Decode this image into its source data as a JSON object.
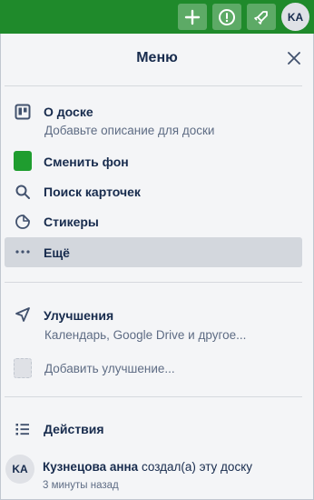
{
  "topbar": {
    "avatar_initials": "KA",
    "buttons": [
      {
        "icon": "plus-icon"
      },
      {
        "icon": "info-icon"
      },
      {
        "icon": "rocket-icon"
      }
    ],
    "background": "#1f8a2b"
  },
  "menu": {
    "title": "Меню",
    "close_icon": "close-icon",
    "items": [
      {
        "label": "О доске",
        "subtitle": "Добавьте описание для доски",
        "icon": "board-icon"
      },
      {
        "label": "Сменить фон",
        "icon": "background-color-swatch",
        "color": "#1f9d2f"
      },
      {
        "label": "Поиск карточек",
        "icon": "search-icon"
      },
      {
        "label": "Стикеры",
        "icon": "sticker-icon"
      },
      {
        "label": "Ещё",
        "icon": "more-icon",
        "highlighted": true
      }
    ],
    "powerups": {
      "label": "Улучшения",
      "subtitle": "Календарь, Google Drive и другое...",
      "icon": "rocket-icon",
      "add_label": "Добавить улучшение..."
    },
    "activity": {
      "label": "Действия",
      "icon": "activity-icon",
      "entries": [
        {
          "avatar": "KA",
          "user": "Кузнецова анна",
          "action": "создал(а) эту доску",
          "time": "3 минуты назад"
        }
      ]
    }
  }
}
